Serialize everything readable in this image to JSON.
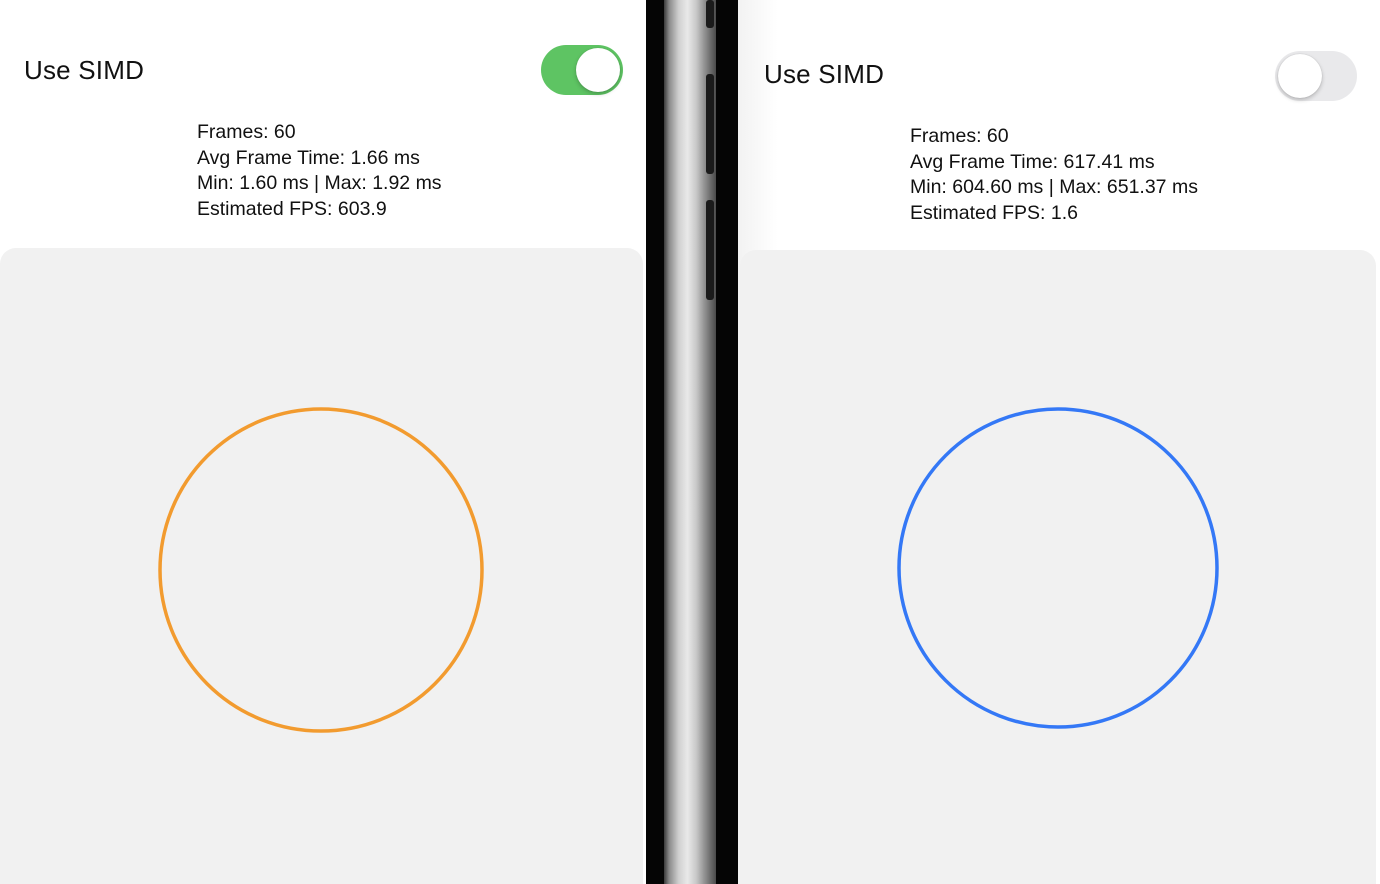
{
  "left_screen": {
    "toggle": {
      "label": "Use SIMD",
      "state": "on"
    },
    "stats": {
      "frames": "Frames: 60",
      "avg_frame_time": "Avg Frame Time: 1.66 ms",
      "min_max": "Min: 1.60 ms | Max: 1.92 ms",
      "estimated_fps": "Estimated FPS: 603.9"
    },
    "circle_color": "#f29b2f"
  },
  "right_screen": {
    "toggle": {
      "label": "Use SIMD",
      "state": "off"
    },
    "stats": {
      "frames": "Frames: 60",
      "avg_frame_time": "Avg Frame Time: 617.41 ms",
      "min_max": "Min: 604.60 ms | Max: 651.37 ms",
      "estimated_fps": "Estimated FPS: 1.6"
    },
    "circle_color": "#3478f6"
  },
  "colors": {
    "switch_on": "#5ec463",
    "switch_off": "#e9e9eb",
    "canvas_background": "#f1f1f1"
  }
}
